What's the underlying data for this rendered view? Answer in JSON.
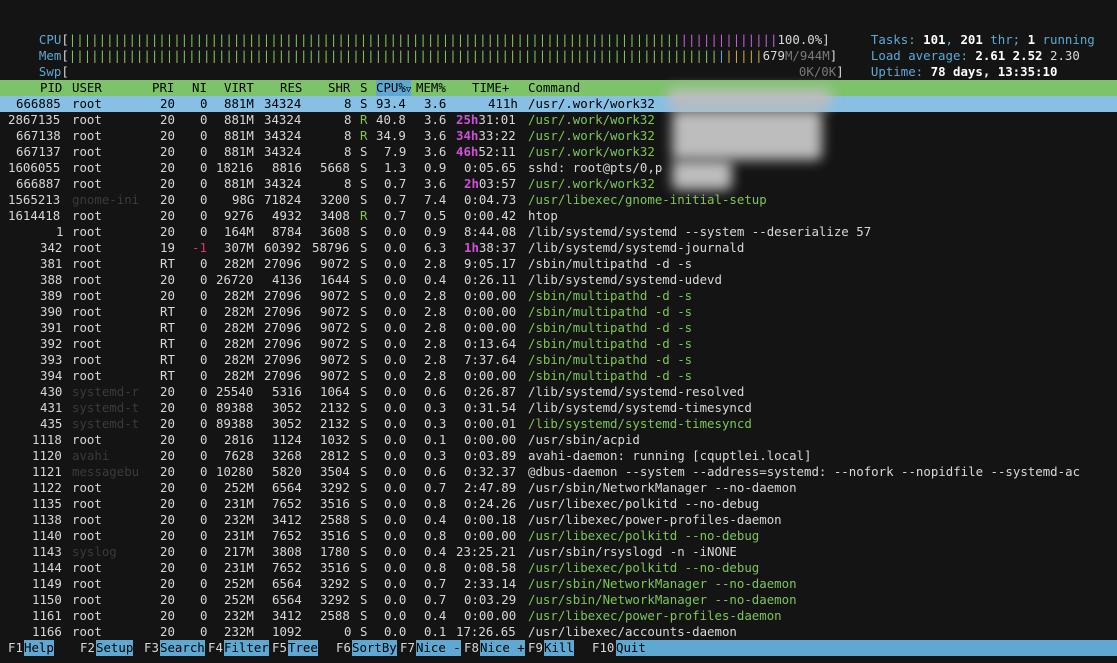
{
  "meters": {
    "cpu": {
      "label": "CPU",
      "value": "100.0%"
    },
    "mem": {
      "label": "Mem",
      "value_part1": "679",
      "value_part2": "M/944M"
    },
    "swp": {
      "label": "Swp",
      "value": "0K/0K"
    }
  },
  "info": {
    "tasks_label": "Tasks: ",
    "tasks": "101",
    "sep1": ", ",
    "threads": "201",
    "thr_label": " thr; ",
    "running": "1",
    "running_label": " running",
    "load_label": "Load average: ",
    "load1": "2.61",
    "load5": "2.52",
    "load15": "2.30",
    "uptime_label": "Uptime: ",
    "uptime": "78 days, 13:35:10"
  },
  "columns": {
    "pid": "PID",
    "user": "USER",
    "pri": "PRI",
    "ni": "NI",
    "virt": "VIRT",
    "res": "RES",
    "shr": "SHR",
    "s": "S",
    "cpu": "CPU%",
    "mem": "MEM%",
    "time": "TIME+",
    "command": "Command"
  },
  "rows": [
    {
      "pid": "666885",
      "user": "root",
      "pri": "20",
      "ni": "0",
      "virt": "881M",
      "res": "34324",
      "shr": "8",
      "s": "S",
      "cpu": "93.4",
      "mem": "3.6",
      "time_a": "",
      "time_b": "411h",
      "cmd": "/usr/.work/work32"
    },
    {
      "pid": "2867135",
      "user": "root",
      "pri": "20",
      "ni": "0",
      "virt": "881M",
      "res": "34324",
      "shr": "8",
      "s": "R",
      "cpu": "40.8",
      "mem": "3.6",
      "time_a": "25h",
      "time_b": "31:01",
      "cmd": "/usr/.work/work32"
    },
    {
      "pid": "667138",
      "user": "root",
      "pri": "20",
      "ni": "0",
      "virt": "881M",
      "res": "34324",
      "shr": "8",
      "s": "R",
      "cpu": "34.9",
      "mem": "3.6",
      "time_a": "34h",
      "time_b": "33:22",
      "cmd": "/usr/.work/work32"
    },
    {
      "pid": "667137",
      "user": "root",
      "pri": "20",
      "ni": "0",
      "virt": "881M",
      "res": "34324",
      "shr": "8",
      "s": "S",
      "cpu": "7.9",
      "mem": "3.6",
      "time_a": "46h",
      "time_b": "52:11",
      "cmd": "/usr/.work/work32"
    },
    {
      "pid": "1606055",
      "user": "root",
      "pri": "20",
      "ni": "0",
      "virt": "18216",
      "res": "8816",
      "shr": "5668",
      "s": "S",
      "cpu": "1.3",
      "mem": "0.9",
      "time_a": "",
      "time_b": "0:05.65",
      "cmd": "sshd: root@pts/0,p"
    },
    {
      "pid": "666887",
      "user": "root",
      "pri": "20",
      "ni": "0",
      "virt": "881M",
      "res": "34324",
      "shr": "8",
      "s": "S",
      "cpu": "0.7",
      "mem": "3.6",
      "time_a": "2h",
      "time_b": "03:57",
      "cmd": "/usr/.work/work32"
    },
    {
      "pid": "1565213",
      "user": "gnome-ini",
      "pri": "20",
      "ni": "0",
      "virt": "98G",
      "res": "71824",
      "shr": "3200",
      "s": "S",
      "cpu": "0.7",
      "mem": "7.4",
      "time_a": "",
      "time_b": "0:04.73",
      "cmd": "/usr/libexec/gnome-initial-setup"
    },
    {
      "pid": "1614418",
      "user": "root",
      "pri": "20",
      "ni": "0",
      "virt": "9276",
      "res": "4932",
      "shr": "3408",
      "s": "R",
      "cpu": "0.7",
      "mem": "0.5",
      "time_a": "",
      "time_b": "0:00.42",
      "cmd": "htop"
    },
    {
      "pid": "1",
      "user": "root",
      "pri": "20",
      "ni": "0",
      "virt": "164M",
      "res": "8784",
      "shr": "3608",
      "s": "S",
      "cpu": "0.0",
      "mem": "0.9",
      "time_a": "",
      "time_b": "8:44.08",
      "cmd": "/lib/systemd/systemd --system --deserialize 57"
    },
    {
      "pid": "342",
      "user": "root",
      "pri": "19",
      "ni": "-1",
      "virt": "307M",
      "res": "60392",
      "shr": "58796",
      "s": "S",
      "cpu": "0.0",
      "mem": "6.3",
      "time_a": "1h",
      "time_b": "38:37",
      "cmd": "/lib/systemd/systemd-journald"
    },
    {
      "pid": "381",
      "user": "root",
      "pri": "RT",
      "ni": "0",
      "virt": "282M",
      "res": "27096",
      "shr": "9072",
      "s": "S",
      "cpu": "0.0",
      "mem": "2.8",
      "time_a": "",
      "time_b": "9:05.17",
      "cmd": "/sbin/multipathd -d -s"
    },
    {
      "pid": "388",
      "user": "root",
      "pri": "20",
      "ni": "0",
      "virt": "26720",
      "res": "4136",
      "shr": "1644",
      "s": "S",
      "cpu": "0.0",
      "mem": "0.4",
      "time_a": "",
      "time_b": "0:26.11",
      "cmd": "/lib/systemd/systemd-udevd"
    },
    {
      "pid": "389",
      "user": "root",
      "pri": "20",
      "ni": "0",
      "virt": "282M",
      "res": "27096",
      "shr": "9072",
      "s": "S",
      "cpu": "0.0",
      "mem": "2.8",
      "time_a": "",
      "time_b": "0:00.00",
      "cmd": "/sbin/multipathd -d -s"
    },
    {
      "pid": "390",
      "user": "root",
      "pri": "RT",
      "ni": "0",
      "virt": "282M",
      "res": "27096",
      "shr": "9072",
      "s": "S",
      "cpu": "0.0",
      "mem": "2.8",
      "time_a": "",
      "time_b": "0:00.00",
      "cmd": "/sbin/multipathd -d -s"
    },
    {
      "pid": "391",
      "user": "root",
      "pri": "RT",
      "ni": "0",
      "virt": "282M",
      "res": "27096",
      "shr": "9072",
      "s": "S",
      "cpu": "0.0",
      "mem": "2.8",
      "time_a": "",
      "time_b": "0:00.00",
      "cmd": "/sbin/multipathd -d -s"
    },
    {
      "pid": "392",
      "user": "root",
      "pri": "RT",
      "ni": "0",
      "virt": "282M",
      "res": "27096",
      "shr": "9072",
      "s": "S",
      "cpu": "0.0",
      "mem": "2.8",
      "time_a": "",
      "time_b": "0:13.64",
      "cmd": "/sbin/multipathd -d -s"
    },
    {
      "pid": "393",
      "user": "root",
      "pri": "RT",
      "ni": "0",
      "virt": "282M",
      "res": "27096",
      "shr": "9072",
      "s": "S",
      "cpu": "0.0",
      "mem": "2.8",
      "time_a": "",
      "time_b": "7:37.64",
      "cmd": "/sbin/multipathd -d -s"
    },
    {
      "pid": "394",
      "user": "root",
      "pri": "RT",
      "ni": "0",
      "virt": "282M",
      "res": "27096",
      "shr": "9072",
      "s": "S",
      "cpu": "0.0",
      "mem": "2.8",
      "time_a": "",
      "time_b": "0:00.00",
      "cmd": "/sbin/multipathd -d -s"
    },
    {
      "pid": "430",
      "user": "systemd-r",
      "pri": "20",
      "ni": "0",
      "virt": "25540",
      "res": "5316",
      "shr": "1064",
      "s": "S",
      "cpu": "0.0",
      "mem": "0.6",
      "time_a": "",
      "time_b": "0:26.87",
      "cmd": "/lib/systemd/systemd-resolved"
    },
    {
      "pid": "431",
      "user": "systemd-t",
      "pri": "20",
      "ni": "0",
      "virt": "89388",
      "res": "3052",
      "shr": "2132",
      "s": "S",
      "cpu": "0.0",
      "mem": "0.3",
      "time_a": "",
      "time_b": "0:31.54",
      "cmd": "/lib/systemd/systemd-timesyncd"
    },
    {
      "pid": "435",
      "user": "systemd-t",
      "pri": "20",
      "ni": "0",
      "virt": "89388",
      "res": "3052",
      "shr": "2132",
      "s": "S",
      "cpu": "0.0",
      "mem": "0.3",
      "time_a": "",
      "time_b": "0:00.01",
      "cmd": "/lib/systemd/systemd-timesyncd"
    },
    {
      "pid": "1118",
      "user": "root",
      "pri": "20",
      "ni": "0",
      "virt": "2816",
      "res": "1124",
      "shr": "1032",
      "s": "S",
      "cpu": "0.0",
      "mem": "0.1",
      "time_a": "",
      "time_b": "0:00.00",
      "cmd": "/usr/sbin/acpid"
    },
    {
      "pid": "1120",
      "user": "avahi",
      "pri": "20",
      "ni": "0",
      "virt": "7628",
      "res": "3268",
      "shr": "2812",
      "s": "S",
      "cpu": "0.0",
      "mem": "0.3",
      "time_a": "",
      "time_b": "0:03.89",
      "cmd": "avahi-daemon: running [cquptlei.local]"
    },
    {
      "pid": "1121",
      "user": "messagebu",
      "pri": "20",
      "ni": "0",
      "virt": "10280",
      "res": "5820",
      "shr": "3504",
      "s": "S",
      "cpu": "0.0",
      "mem": "0.6",
      "time_a": "",
      "time_b": "0:32.37",
      "cmd": "@dbus-daemon --system --address=systemd: --nofork --nopidfile --systemd-ac"
    },
    {
      "pid": "1122",
      "user": "root",
      "pri": "20",
      "ni": "0",
      "virt": "252M",
      "res": "6564",
      "shr": "3292",
      "s": "S",
      "cpu": "0.0",
      "mem": "0.7",
      "time_a": "",
      "time_b": "2:47.89",
      "cmd": "/usr/sbin/NetworkManager --no-daemon"
    },
    {
      "pid": "1135",
      "user": "root",
      "pri": "20",
      "ni": "0",
      "virt": "231M",
      "res": "7652",
      "shr": "3516",
      "s": "S",
      "cpu": "0.0",
      "mem": "0.8",
      "time_a": "",
      "time_b": "0:24.26",
      "cmd": "/usr/libexec/polkitd --no-debug"
    },
    {
      "pid": "1138",
      "user": "root",
      "pri": "20",
      "ni": "0",
      "virt": "232M",
      "res": "3412",
      "shr": "2588",
      "s": "S",
      "cpu": "0.0",
      "mem": "0.4",
      "time_a": "",
      "time_b": "0:00.18",
      "cmd": "/usr/libexec/power-profiles-daemon"
    },
    {
      "pid": "1140",
      "user": "root",
      "pri": "20",
      "ni": "0",
      "virt": "231M",
      "res": "7652",
      "shr": "3516",
      "s": "S",
      "cpu": "0.0",
      "mem": "0.8",
      "time_a": "",
      "time_b": "0:00.00",
      "cmd": "/usr/libexec/polkitd --no-debug"
    },
    {
      "pid": "1143",
      "user": "syslog",
      "pri": "20",
      "ni": "0",
      "virt": "217M",
      "res": "3808",
      "shr": "1780",
      "s": "S",
      "cpu": "0.0",
      "mem": "0.4",
      "time_a": "",
      "time_b": "23:25.21",
      "cmd": "/usr/sbin/rsyslogd -n -iNONE"
    },
    {
      "pid": "1144",
      "user": "root",
      "pri": "20",
      "ni": "0",
      "virt": "231M",
      "res": "7652",
      "shr": "3516",
      "s": "S",
      "cpu": "0.0",
      "mem": "0.8",
      "time_a": "",
      "time_b": "0:08.58",
      "cmd": "/usr/libexec/polkitd --no-debug"
    },
    {
      "pid": "1149",
      "user": "root",
      "pri": "20",
      "ni": "0",
      "virt": "252M",
      "res": "6564",
      "shr": "3292",
      "s": "S",
      "cpu": "0.0",
      "mem": "0.7",
      "time_a": "",
      "time_b": "2:33.14",
      "cmd": "/usr/sbin/NetworkManager --no-daemon"
    },
    {
      "pid": "1150",
      "user": "root",
      "pri": "20",
      "ni": "0",
      "virt": "252M",
      "res": "6564",
      "shr": "3292",
      "s": "S",
      "cpu": "0.0",
      "mem": "0.7",
      "time_a": "",
      "time_b": "0:03.29",
      "cmd": "/usr/sbin/NetworkManager --no-daemon"
    },
    {
      "pid": "1161",
      "user": "root",
      "pri": "20",
      "ni": "0",
      "virt": "232M",
      "res": "3412",
      "shr": "2588",
      "s": "S",
      "cpu": "0.0",
      "mem": "0.4",
      "time_a": "",
      "time_b": "0:00.00",
      "cmd": "/usr/libexec/power-profiles-daemon"
    },
    {
      "pid": "1166",
      "user": "root",
      "pri": "20",
      "ni": "0",
      "virt": "232M",
      "res": "1092",
      "shr": "0",
      "s": "S",
      "cpu": "0.0",
      "mem": "0.1",
      "time_a": "",
      "time_b": "17:26.65",
      "cmd": "/usr/libexec/accounts-daemon"
    }
  ],
  "fkeys": [
    {
      "num": "F1",
      "label": "Help"
    },
    {
      "num": "F2",
      "label": "Setup"
    },
    {
      "num": "F3",
      "label": "Search"
    },
    {
      "num": "F4",
      "label": "Filter"
    },
    {
      "num": "F5",
      "label": "Tree"
    },
    {
      "num": "F6",
      "label": "SortBy"
    },
    {
      "num": "F7",
      "label": "Nice -"
    },
    {
      "num": "F8",
      "label": "Nice +"
    },
    {
      "num": "F9",
      "label": "Kill"
    },
    {
      "num": "F10",
      "label": "Quit"
    }
  ],
  "colors": {
    "accent": "#5fa8d3",
    "header_bg": "#7cc36a",
    "selected_bg": "#87bfe5",
    "background": "#141414"
  }
}
